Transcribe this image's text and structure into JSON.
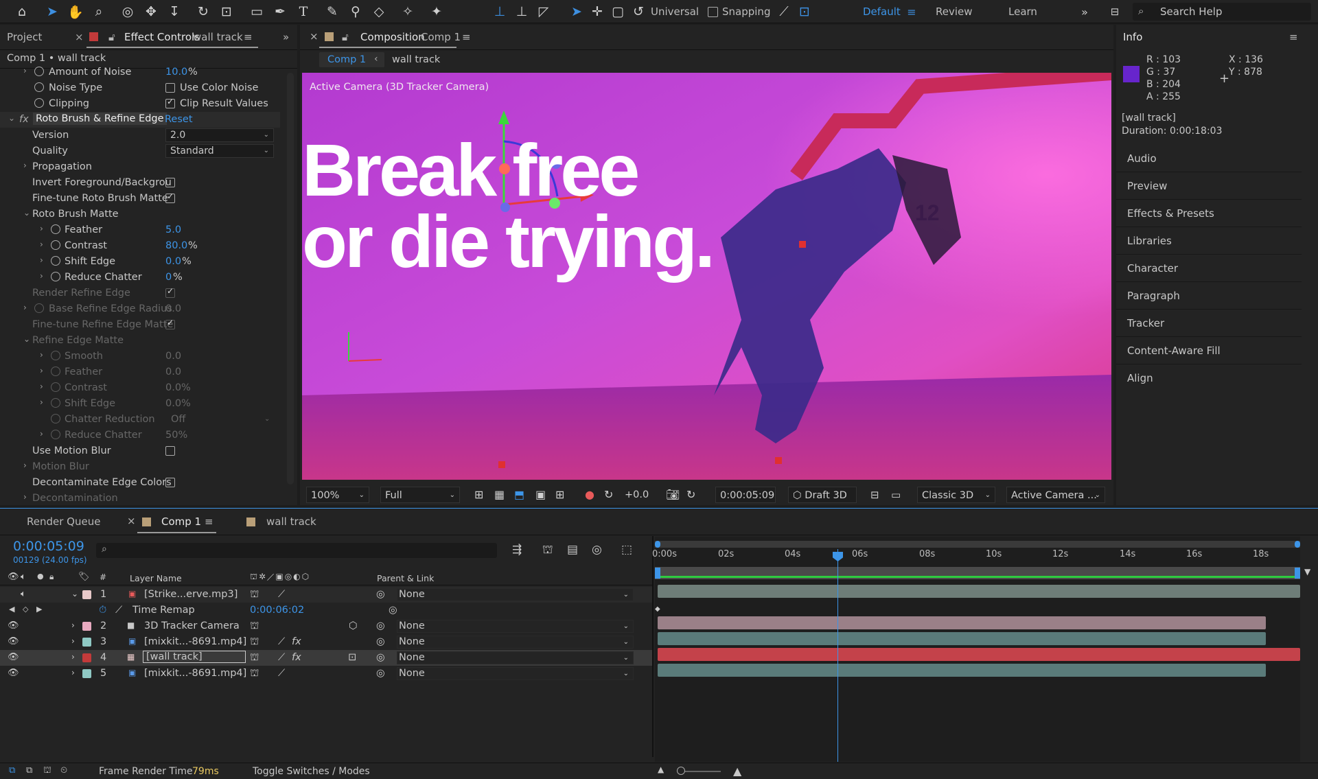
{
  "toolbar": {
    "axis_mode": "Universal",
    "snapping": "Snapping",
    "workspaces": [
      "Default",
      "Review",
      "Learn"
    ],
    "search_placeholder": "Search Help"
  },
  "left_panel": {
    "tab_project": "Project",
    "tab_effect_controls": "Effect Controls",
    "tab_effect_layer": "wall track",
    "breadcrumb": "Comp 1 • wall track",
    "rows": {
      "amount_noise": {
        "label": "Amount of Noise",
        "value": "10.0",
        "unit": "%"
      },
      "noise_type": {
        "label": "Noise Type",
        "value": "Use Color Noise"
      },
      "clipping": {
        "label": "Clipping",
        "value": "Clip Result Values"
      },
      "effect_name": "Roto Brush & Refine Edge",
      "reset": "Reset",
      "version": {
        "label": "Version",
        "value": "2.0"
      },
      "quality": {
        "label": "Quality",
        "value": "Standard"
      },
      "propagation": "Propagation",
      "invert_fg": "Invert Foreground/Backgrou",
      "finetune_roto": "Fine-tune Roto Brush Matte",
      "roto_matte": "Roto Brush Matte",
      "feather": {
        "label": "Feather",
        "value": "5.0"
      },
      "contrast": {
        "label": "Contrast",
        "value": "80.0",
        "unit": "%"
      },
      "shift_edge": {
        "label": "Shift Edge",
        "value": "0.0",
        "unit": "%"
      },
      "reduce_chatter": {
        "label": "Reduce Chatter",
        "value": "0",
        "unit": "%"
      },
      "render_refine": "Render Refine Edge",
      "base_refine": {
        "label": "Base Refine Edge Radius",
        "value": "0.0"
      },
      "finetune_refine": "Fine-tune Refine Edge Matte",
      "refine_matte": "Refine Edge Matte",
      "smooth": {
        "label": "Smooth",
        "value": "0.0"
      },
      "feather2": {
        "label": "Feather",
        "value": "0.0"
      },
      "contrast2": {
        "label": "Contrast",
        "value": "0.0%"
      },
      "shift_edge2": {
        "label": "Shift Edge",
        "value": "0.0%"
      },
      "chatter_reduction": {
        "label": "Chatter Reduction",
        "value": "Off"
      },
      "reduce_chatter2": {
        "label": "Reduce Chatter",
        "value": "50%"
      },
      "motion_blur": "Use Motion Blur",
      "motion_blur_group": "Motion Blur",
      "decontam_colors": "Decontaminate Edge Colors",
      "decontamination": "Decontamination"
    }
  },
  "composition": {
    "tab_label": "Composition",
    "tab_name": "Comp 1",
    "crumb_comp": "Comp 1",
    "crumb_layer": "wall track",
    "camera_label": "Active Camera (3D Tracker Camera)",
    "overlay_line1": "Break free",
    "overlay_line2": "or die trying.",
    "wall_number": "12",
    "zoom": "100%",
    "resolution": "Full",
    "exposure": "+0.0",
    "timecode": "0:00:05:09",
    "draft": "Draft 3D",
    "renderer": "Classic 3D",
    "view": "Active Camera ..."
  },
  "info": {
    "title": "Info",
    "color": "#6725cc",
    "r": "R : 103",
    "g": "G : 37",
    "b": "B : 204",
    "a": "A : 255",
    "x": "X : 136",
    "y": "Y : 878",
    "layer": "[wall track]",
    "duration": "Duration: 0:00:18:03",
    "sections": [
      "Audio",
      "Preview",
      "Effects & Presets",
      "Libraries",
      "Character",
      "Paragraph",
      "Tracker",
      "Content-Aware Fill",
      "Align"
    ]
  },
  "timeline": {
    "tab_render_queue": "Render Queue",
    "tab_comp": "Comp 1",
    "tab_wall": "wall track",
    "timecode": "0:00:05:09",
    "frame_info": "00129 (24.00 fps)",
    "col_layer_name": "Layer Name",
    "col_num": "#",
    "col_parent": "Parent & Link",
    "ruler": [
      "0:00s",
      "02s",
      "04s",
      "06s",
      "08s",
      "10s",
      "12s",
      "14s",
      "16s",
      "18s"
    ],
    "time_remap": {
      "label": "Time Remap",
      "value": "0:00:06:02"
    },
    "layers": [
      {
        "num": "1",
        "name": "[Strike...erve.mp3]",
        "color": "#e8c9c9",
        "parent": "None"
      },
      {
        "num": "2",
        "name": "3D Tracker Camera",
        "color": "#e8aac0",
        "parent": "None"
      },
      {
        "num": "3",
        "name": "[mixkit...-8691.mp4]",
        "color": "#8fc9c4",
        "parent": "None"
      },
      {
        "num": "4",
        "name": "[wall track]",
        "color": "#c23a3a",
        "parent": "None"
      },
      {
        "num": "5",
        "name": "[mixkit...-8691.mp4]",
        "color": "#8fc9c4",
        "parent": "None"
      }
    ],
    "footer_render": "Frame Render Time",
    "footer_render_value": "79ms",
    "footer_toggle": "Toggle Switches / Modes"
  }
}
